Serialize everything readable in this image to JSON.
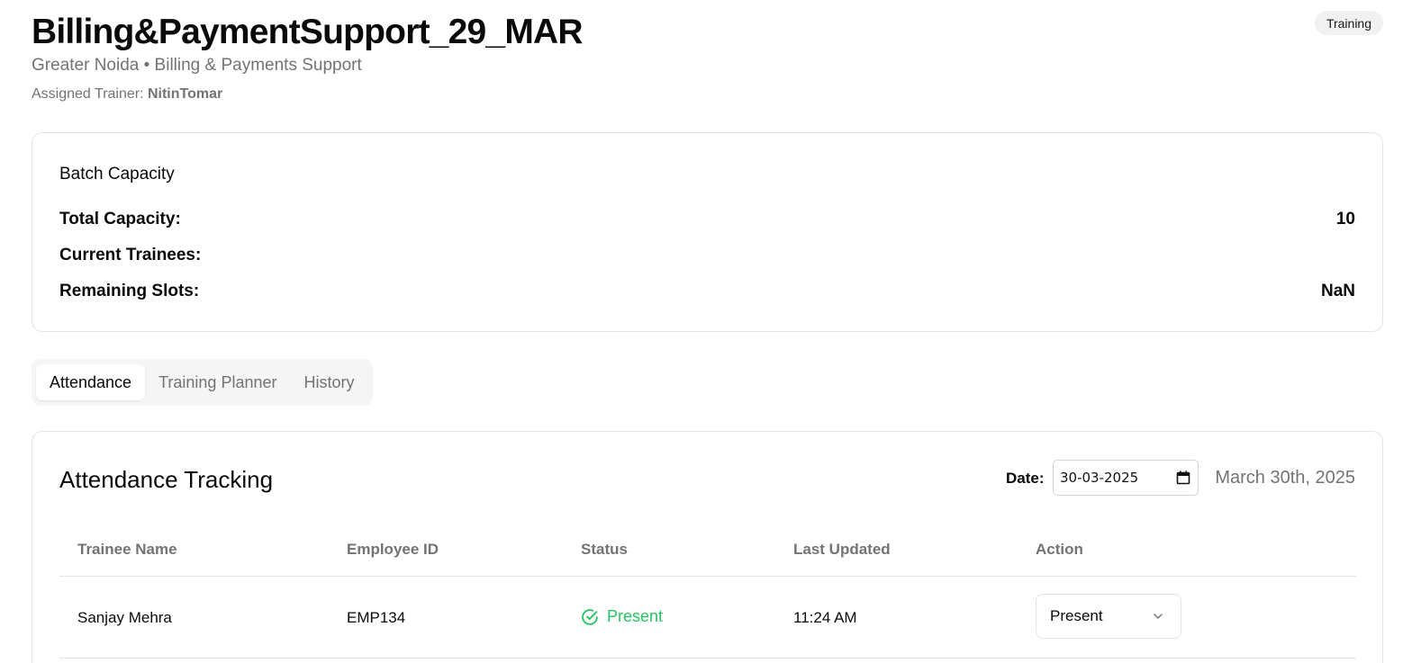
{
  "header": {
    "title": "Billing&PaymentSupport_29_MAR",
    "subtitle": "Greater Noida • Billing & Payments Support",
    "trainer_label": "Assigned Trainer:",
    "trainer_name": "NitinTomar",
    "badge": "Training"
  },
  "capacity": {
    "heading": "Batch Capacity",
    "rows": [
      {
        "label": "Total Capacity:",
        "value": "10"
      },
      {
        "label": "Current Trainees:",
        "value": ""
      },
      {
        "label": "Remaining Slots:",
        "value": "NaN"
      }
    ]
  },
  "tabs": [
    {
      "label": "Attendance",
      "active": true
    },
    {
      "label": "Training Planner",
      "active": false
    },
    {
      "label": "History",
      "active": false
    }
  ],
  "attendance": {
    "title": "Attendance Tracking",
    "date_label": "Date:",
    "date_value": "30-03-2025",
    "date_long": "March 30th, 2025",
    "columns": [
      "Trainee Name",
      "Employee ID",
      "Status",
      "Last Updated",
      "Action"
    ],
    "rows": [
      {
        "name": "Sanjay Mehra",
        "employee_id": "EMP134",
        "status": "Present",
        "last_updated": "11:24 AM",
        "action": "Present"
      }
    ]
  },
  "colors": {
    "present_green": "#22c55e",
    "muted_text": "#737373",
    "border": "#e5e5e5"
  },
  "icons": {
    "status": "check-circle-icon",
    "date": "calendar-icon",
    "dropdown": "chevron-down-icon"
  }
}
